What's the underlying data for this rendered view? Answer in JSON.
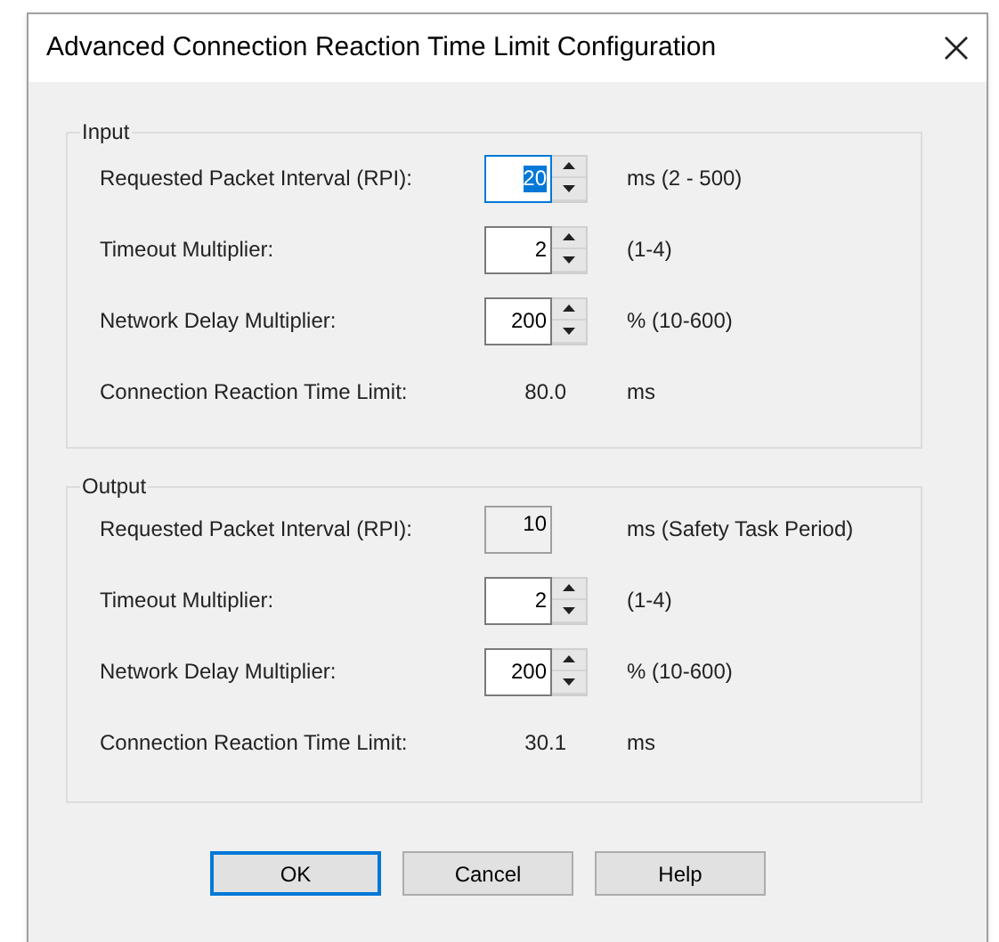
{
  "window": {
    "title": "Advanced Connection Reaction Time Limit Configuration"
  },
  "groups": [
    {
      "title": "Input",
      "rows": [
        {
          "kind": "spin",
          "label": "Requested Packet Interval (RPI):",
          "value": "20",
          "selected": true,
          "unit": "ms (2 - 500)"
        },
        {
          "kind": "spin",
          "label": "Timeout Multiplier:",
          "value": "2",
          "selected": false,
          "unit": "(1-4)"
        },
        {
          "kind": "spin",
          "label": "Network Delay Multiplier:",
          "value": "200",
          "selected": false,
          "unit": "% (10-600)"
        },
        {
          "kind": "readout",
          "label": "Connection Reaction Time Limit:",
          "value": "80.0",
          "unit": "ms"
        }
      ]
    },
    {
      "title": "Output",
      "rows": [
        {
          "kind": "readonly",
          "label": "Requested Packet Interval (RPI):",
          "value": "10",
          "unit": "ms (Safety Task Period)"
        },
        {
          "kind": "spin",
          "label": "Timeout Multiplier:",
          "value": "2",
          "selected": false,
          "unit": "(1-4)"
        },
        {
          "kind": "spin",
          "label": "Network Delay Multiplier:",
          "value": "200",
          "selected": false,
          "unit": "% (10-600)"
        },
        {
          "kind": "readout",
          "label": "Connection Reaction Time Limit:",
          "value": "30.1",
          "unit": "ms"
        }
      ]
    }
  ],
  "buttons": [
    {
      "label": "OK",
      "default": true
    },
    {
      "label": "Cancel",
      "default": false
    },
    {
      "label": "Help",
      "default": false
    }
  ]
}
